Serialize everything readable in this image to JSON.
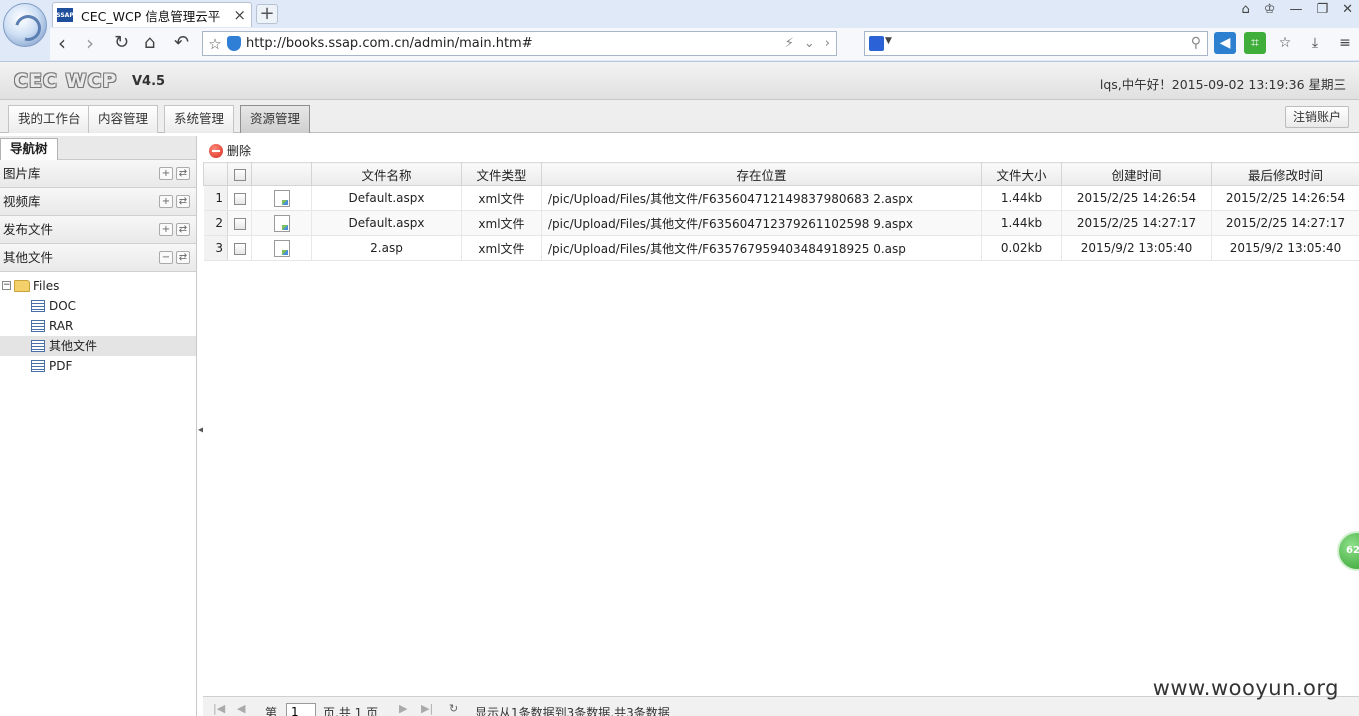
{
  "browser": {
    "tab_title": "CEC_WCP 信息管理云平",
    "tab_favicon_text": "SSAP",
    "address": "http://books.ssap.com.cn/admin/main.htm#"
  },
  "app": {
    "logo": "CEC WCP",
    "version": "V4.5",
    "greeting": "lqs,中午好！2015-09-02 13:19:36 星期三",
    "logout_label": "注销账户"
  },
  "main_tabs": [
    "我的工作台",
    "内容管理",
    "系统管理",
    "资源管理"
  ],
  "active_main_tab": "资源管理",
  "nav": {
    "tab_label": "导航树",
    "sections": [
      "图片库",
      "视频库",
      "发布文件",
      "其他文件"
    ],
    "tree": {
      "root": "Files",
      "children": [
        "DOC",
        "RAR",
        "其他文件",
        "PDF"
      ],
      "selected": "其他文件"
    }
  },
  "toolbar": {
    "delete_label": "删除"
  },
  "table": {
    "columns": [
      "文件名称",
      "文件类型",
      "存在位置",
      "文件大小",
      "创建时间",
      "最后修改时间"
    ],
    "rows": [
      {
        "num": "1",
        "name": "Default.aspx",
        "type": "xml文件",
        "path": "/pic/Upload/Files/其他文件/F635604712149837980683 2.aspx",
        "size": "1.44kb",
        "created": "2015/2/25 14:26:54",
        "modified": "2015/2/25 14:26:54"
      },
      {
        "num": "2",
        "name": "Default.aspx",
        "type": "xml文件",
        "path": "/pic/Upload/Files/其他文件/F635604712379261102598 9.aspx",
        "size": "1.44kb",
        "created": "2015/2/25 14:27:17",
        "modified": "2015/2/25 14:27:17"
      },
      {
        "num": "3",
        "name": "2.asp",
        "type": "xml文件",
        "path": "/pic/Upload/Files/其他文件/F635767959403484918925 0.asp",
        "size": "0.02kb",
        "created": "2015/9/2 13:05:40",
        "modified": "2015/9/2 13:05:40"
      }
    ]
  },
  "pager": {
    "page_prefix": "第",
    "page_value": "1",
    "page_suffix": "页,共 1 页",
    "summary": "显示从1条数据到3条数据,共3条数据"
  },
  "watermark": "www.wooyun.org",
  "bubble_text": "62"
}
